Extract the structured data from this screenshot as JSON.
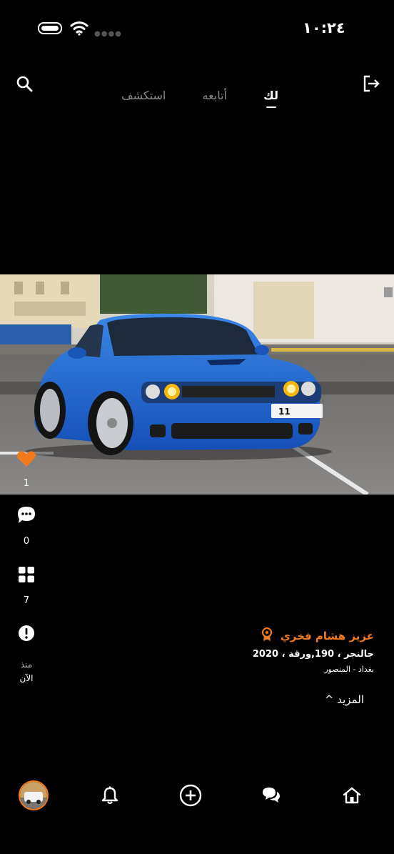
{
  "status_bar": {
    "time": "١٠:٢٤"
  },
  "top_tabs": [
    {
      "label": "لك",
      "active": true
    },
    {
      "label": "أتابعه",
      "active": false
    },
    {
      "label": "استكشف",
      "active": false
    }
  ],
  "post": {
    "likes": "1",
    "comments": "0",
    "images": "7",
    "time_ago_line1": "منذ",
    "time_ago_line2": "الآن",
    "plate_text": "11",
    "seller_name": "عزيز هشام فخري",
    "details": "جالنجر ، 190,ورقة ، 2020",
    "location": "بغداد - المنصور",
    "more_label": "المزيد ^"
  },
  "colors": {
    "accent": "#f07a1c",
    "background": "#000000",
    "car": "#1e5fc4"
  }
}
